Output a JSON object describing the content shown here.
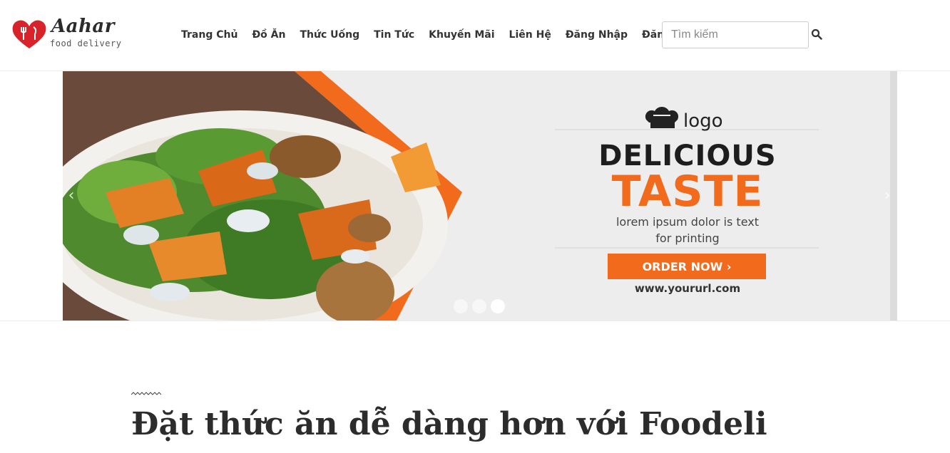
{
  "brand": {
    "name": "Aahar",
    "tagline": "food delivery",
    "color": "#d8232a"
  },
  "nav": {
    "items": [
      {
        "label": "Trang Chủ"
      },
      {
        "label": "Đồ Ăn"
      },
      {
        "label": "Thức Uống"
      },
      {
        "label": "Tin Tức"
      },
      {
        "label": "Khuyến Mãi"
      },
      {
        "label": "Liên Hệ"
      },
      {
        "label": "Đăng Nhập"
      },
      {
        "label": "Đăng Kí"
      }
    ]
  },
  "search": {
    "placeholder": "Tìm kiếm",
    "value": "",
    "icon": "search-icon"
  },
  "carousel": {
    "prev_icon": "chevron-left-icon",
    "next_icon": "chevron-right-icon",
    "prev_glyph": "‹",
    "next_glyph": "›",
    "slide_count": 3,
    "active_index": 2,
    "banner": {
      "logo_text": "logo",
      "headline": "DELICIOUS",
      "highlight": "TASTE",
      "tagline_line1": "lorem ipsum dolor is text",
      "tagline_line2": "for printing",
      "cta": "ORDER NOW  ›",
      "url": "www.yoururl.com",
      "accent_color": "#f26a1b"
    }
  },
  "content": {
    "headline": "Đặt thức ăn dễ dàng hơn với Foodeli"
  }
}
